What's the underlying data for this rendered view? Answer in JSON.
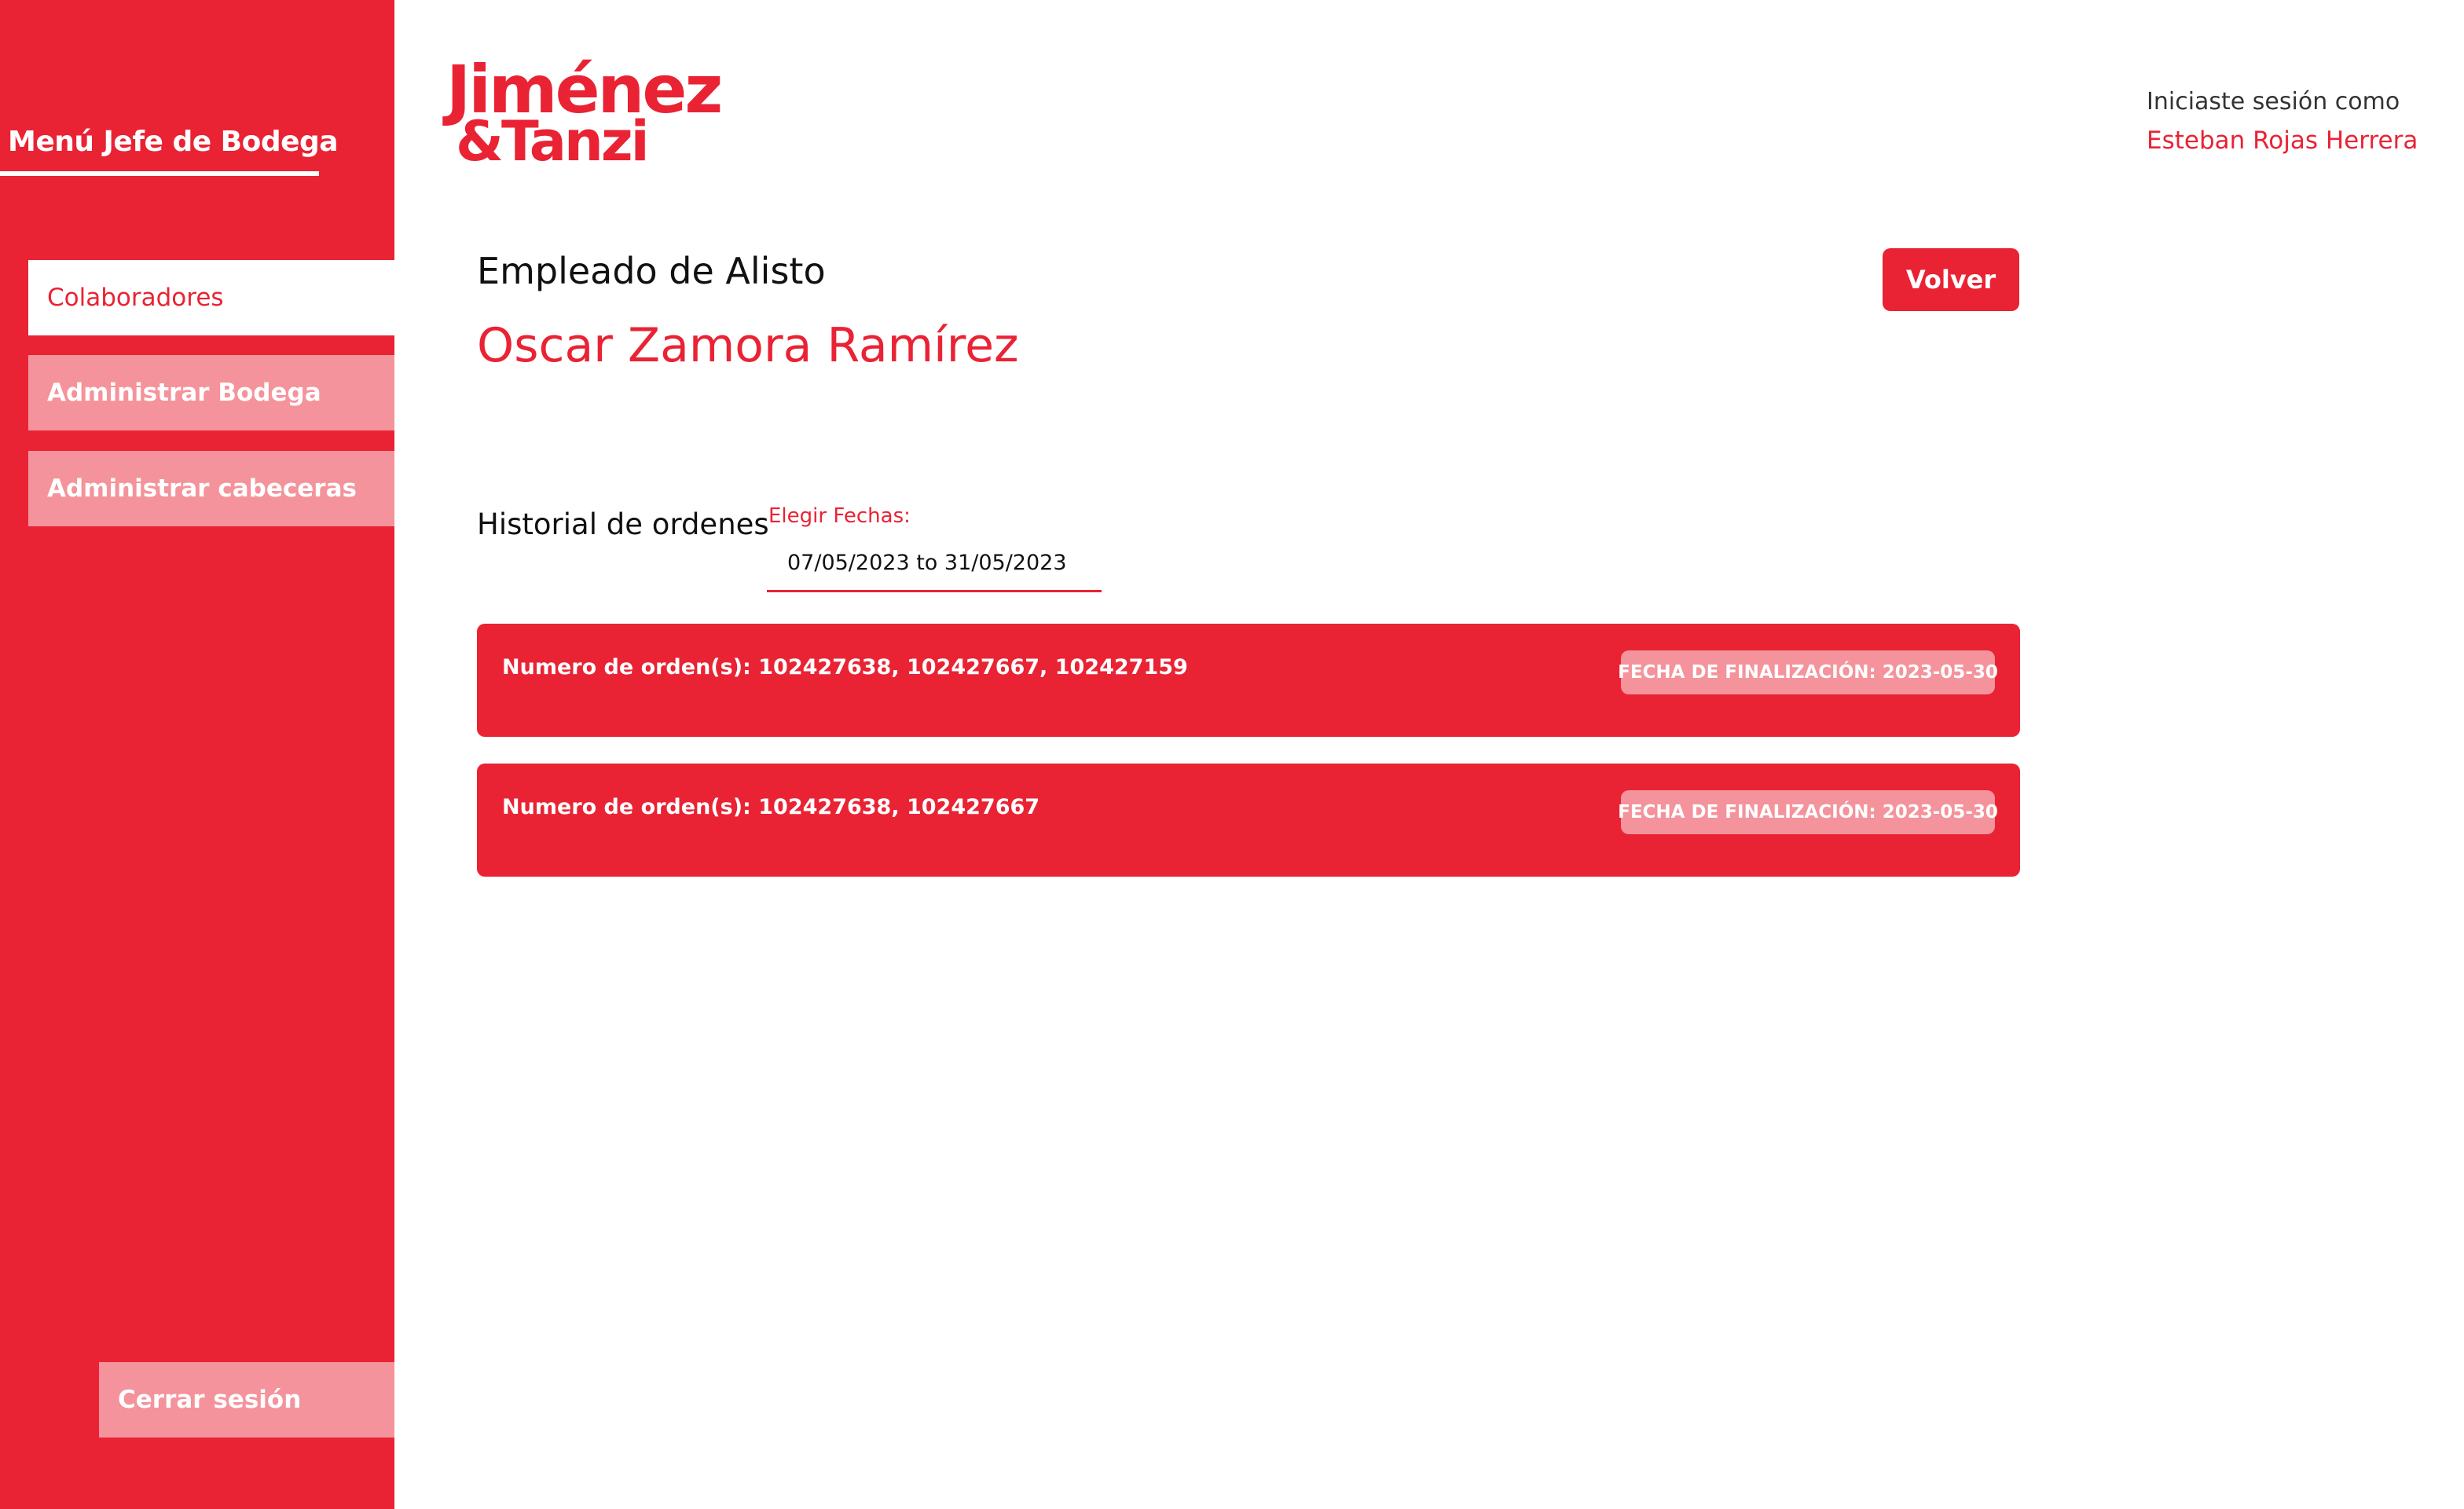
{
  "sidebar": {
    "title": "Menú Jefe de Bodega",
    "items": [
      {
        "label": "Colaboradores",
        "active": true
      },
      {
        "label": "Administrar Bodega",
        "active": false
      },
      {
        "label": "Administrar cabeceras",
        "active": false
      }
    ],
    "logout_label": "Cerrar sesión"
  },
  "logo": {
    "line1": "Jiménez",
    "line2": "&Tanzi"
  },
  "session": {
    "label": "Iniciaste sesión como",
    "user": "Esteban Rojas Herrera"
  },
  "employee": {
    "role": "Empleado de Alisto",
    "name": "Oscar Zamora Ramírez"
  },
  "buttons": {
    "back_label": "Volver"
  },
  "history": {
    "title": "Historial de ordenes",
    "date_label": "Elegir Fechas:",
    "date_range": "07/05/2023 to 31/05/2023"
  },
  "orders": [
    {
      "numbers": "Numero de orden(s): 102427638, 102427667, 102427159",
      "badge": "FECHA DE FINALIZACIÓN: 2023-05-30"
    },
    {
      "numbers": "Numero de orden(s): 102427638, 102427667",
      "badge": "FECHA DE FINALIZACIÓN: 2023-05-30"
    }
  ],
  "colors": {
    "brand_red": "#e92334",
    "light_red": "#f4939b",
    "background": "#ffffff"
  }
}
